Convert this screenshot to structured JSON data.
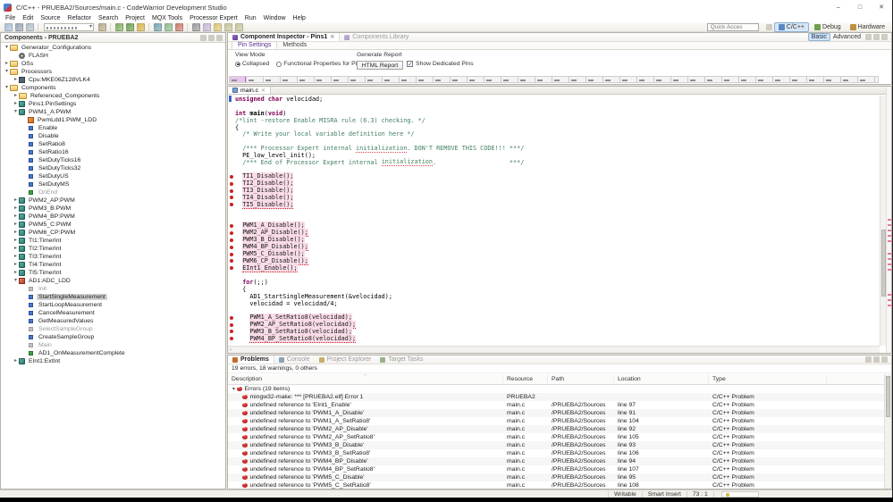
{
  "window": {
    "title": "C/C++ - PRUEBA2/Sources/main.c - CodeWarrior Development Studio",
    "controls": {
      "minimize": "–",
      "restore": "□",
      "close": "✕"
    }
  },
  "menu": {
    "items": [
      "File",
      "Edit",
      "Source",
      "Refactor",
      "Search",
      "Project",
      "MQX Tools",
      "Processor Expert",
      "Run",
      "Window",
      "Help"
    ]
  },
  "toolbar": {
    "quick_access": "Quick Acces",
    "icons": [
      {
        "name": "new-wizard-icon",
        "color": "#a8bed8"
      },
      {
        "name": "save-icon",
        "color": "#9aa7b5"
      },
      {
        "name": "save-all-icon",
        "color": "#b4bec8"
      },
      {
        "name": "build-icon",
        "color": "#b9a98a"
      },
      {
        "name": "debug-icon",
        "color": "#7fae5f"
      },
      {
        "name": "run-icon",
        "color": "#6f9e4f"
      },
      {
        "name": "flash-programmer-icon",
        "color": "#d8b44a"
      },
      {
        "name": "step-icon",
        "color": "#76a5af"
      },
      {
        "name": "resume-icon",
        "color": "#8fbc8f"
      },
      {
        "name": "terminate-icon",
        "color": "#c97a6a"
      },
      {
        "name": "search-icon",
        "color": "#9a9a9a"
      },
      {
        "name": "annotation-icon",
        "color": "#c8b8d8"
      },
      {
        "name": "mark-icon",
        "color": "#d8c878"
      },
      {
        "name": "nav-back-icon",
        "color": "#c8c49a"
      },
      {
        "name": "nav-forward-icon",
        "color": "#c8c49a"
      }
    ],
    "perspectives": [
      {
        "label": "C/C++",
        "active": true,
        "color": "#5a87c6"
      },
      {
        "label": "Debug",
        "active": false,
        "color": "#6fa050"
      },
      {
        "label": "Hardware",
        "active": false,
        "color": "#c09040"
      }
    ]
  },
  "components_view": {
    "title": "Components - PRUEBA2",
    "tree": [
      {
        "label": "Generator_Configurations",
        "lvl": 0,
        "arrow": "exp",
        "icon": "folder"
      },
      {
        "label": "FLASH",
        "lvl": 1,
        "arrow": null,
        "icon": "gear"
      },
      {
        "label": "OSs",
        "lvl": 0,
        "arrow": "col",
        "icon": "folder"
      },
      {
        "label": "Processors",
        "lvl": 0,
        "arrow": "exp",
        "icon": "folder"
      },
      {
        "label": "Cpu:MKE06Z128VLK4",
        "lvl": 1,
        "arrow": "col",
        "icon": "cpu"
      },
      {
        "label": "Components",
        "lvl": 0,
        "arrow": "exp",
        "icon": "folder"
      },
      {
        "label": "Referenced_Components",
        "lvl": 1,
        "arrow": "col",
        "icon": "folder"
      },
      {
        "label": "Pins1:PinSettings",
        "lvl": 1,
        "arrow": "col",
        "icon": "comp"
      },
      {
        "label": "PWM1_A:PWM",
        "lvl": 1,
        "arrow": "exp",
        "icon": "comp"
      },
      {
        "label": "PwmLdd1:PWM_LDD",
        "lvl": 2,
        "arrow": null,
        "icon": "ldd"
      },
      {
        "label": "Enable",
        "lvl": 2,
        "arrow": null,
        "icon": "method"
      },
      {
        "label": "Disable",
        "lvl": 2,
        "arrow": null,
        "icon": "method"
      },
      {
        "label": "SetRatio8",
        "lvl": 2,
        "arrow": null,
        "icon": "method"
      },
      {
        "label": "SetRatio16",
        "lvl": 2,
        "arrow": null,
        "icon": "method"
      },
      {
        "label": "SetDutyTicks16",
        "lvl": 2,
        "arrow": null,
        "icon": "method"
      },
      {
        "label": "SetDutyTicks32",
        "lvl": 2,
        "arrow": null,
        "icon": "method"
      },
      {
        "label": "SetDutyUS",
        "lvl": 2,
        "arrow": null,
        "icon": "method"
      },
      {
        "label": "SetDutyMS",
        "lvl": 2,
        "arrow": null,
        "icon": "method"
      },
      {
        "label": "OnEnd",
        "lvl": 2,
        "arrow": null,
        "icon": "event",
        "gray": true
      },
      {
        "label": "PWM2_AP:PWM",
        "lvl": 1,
        "arrow": "col",
        "icon": "comp"
      },
      {
        "label": "PWM3_B:PWM",
        "lvl": 1,
        "arrow": "col",
        "icon": "comp"
      },
      {
        "label": "PWM4_BP:PWM",
        "lvl": 1,
        "arrow": "col",
        "icon": "comp"
      },
      {
        "label": "PWM5_C:PWM",
        "lvl": 1,
        "arrow": "col",
        "icon": "comp"
      },
      {
        "label": "PWM6_CP:PWM",
        "lvl": 1,
        "arrow": "col",
        "icon": "comp"
      },
      {
        "label": "TI1:TimerInt",
        "lvl": 1,
        "arrow": "col",
        "icon": "comp"
      },
      {
        "label": "TI2:TimerInt",
        "lvl": 1,
        "arrow": "col",
        "icon": "comp"
      },
      {
        "label": "TI3:TimerInt",
        "lvl": 1,
        "arrow": "col",
        "icon": "comp"
      },
      {
        "label": "TI4:TimerInt",
        "lvl": 1,
        "arrow": "col",
        "icon": "comp"
      },
      {
        "label": "TI5:TimerInt",
        "lvl": 1,
        "arrow": "col",
        "icon": "comp"
      },
      {
        "label": "AD1:ADC_LDD",
        "lvl": 1,
        "arrow": "exp",
        "icon": "adc"
      },
      {
        "label": "Init",
        "lvl": 2,
        "arrow": null,
        "icon": "method_gray",
        "gray": true
      },
      {
        "label": "StartSingleMeasurement",
        "lvl": 2,
        "arrow": null,
        "icon": "method",
        "sel": true
      },
      {
        "label": "StartLoopMeasurement",
        "lvl": 2,
        "arrow": null,
        "icon": "method"
      },
      {
        "label": "CancelMeasurement",
        "lvl": 2,
        "arrow": null,
        "icon": "method"
      },
      {
        "label": "GetMeasuredValues",
        "lvl": 2,
        "arrow": null,
        "icon": "method"
      },
      {
        "label": "SelectSampleGroup",
        "lvl": 2,
        "arrow": null,
        "icon": "method_gray",
        "gray": true
      },
      {
        "label": "CreateSampleGroup",
        "lvl": 2,
        "arrow": null,
        "icon": "method"
      },
      {
        "label": "Main",
        "lvl": 2,
        "arrow": null,
        "icon": "method_gray",
        "gray": true
      },
      {
        "label": "AD1_OnMeasurementComplete",
        "lvl": 2,
        "arrow": null,
        "icon": "event"
      },
      {
        "label": "EInt1:ExtInt",
        "lvl": 1,
        "arrow": "col",
        "icon": "comp"
      }
    ]
  },
  "inspector": {
    "tab_active": "Component Inspector - Pins1",
    "tab_inactive": "Components Library",
    "subtab_pin": "Pin Settings",
    "subtab_methods": "Methods",
    "view_mode_label": "View Mode",
    "radio_collapsed": "Collapsed",
    "radio_functional": "Functional Properties for Pins",
    "generate_report_label": "Generate Report",
    "report_button": "HTML Report",
    "dedicated_pins_label": "Show Dedicated Pins",
    "dedicated_pins_checked": "✓",
    "basic_tab": "Basic",
    "advanced_tab": "Advanced"
  },
  "editor": {
    "tab": "main.c",
    "close_glyph": "✕",
    "hscroll_arrow": "‹",
    "error_color": "#cc2222",
    "keyword_color": "#7f0055",
    "comment_color": "#3f7f5f",
    "lines": [
      {
        "m": "cur",
        "s": [
          [
            "k",
            "unsigned"
          ],
          [
            "p",
            " "
          ],
          [
            "k",
            "char"
          ],
          [
            "p",
            " velocidad;"
          ]
        ]
      },
      {
        "m": null,
        "s": []
      },
      {
        "m": null,
        "s": [
          [
            "k",
            "int"
          ],
          [
            "p",
            " "
          ],
          [
            "b",
            "main"
          ],
          [
            "p",
            "("
          ],
          [
            "k",
            "void"
          ],
          [
            "p",
            ")"
          ]
        ]
      },
      {
        "m": null,
        "s": [
          [
            "c",
            "/*lint -restore Enable MISRA rule (6.3) checking. */"
          ]
        ]
      },
      {
        "m": null,
        "s": [
          [
            "p",
            "{"
          ]
        ]
      },
      {
        "m": null,
        "s": [
          [
            "p",
            "  "
          ],
          [
            "c",
            "/* Write your local variable definition here */"
          ]
        ]
      },
      {
        "m": null,
        "s": []
      },
      {
        "m": null,
        "s": [
          [
            "p",
            "  "
          ],
          [
            "c",
            "/*** Processor Expert internal "
          ],
          [
            "cu",
            "initialization"
          ],
          [
            "c",
            ". DON'T REMOVE THIS CODE!!! ***/"
          ]
        ]
      },
      {
        "m": null,
        "s": [
          [
            "p",
            "  PE_low_level_init();"
          ]
        ]
      },
      {
        "m": null,
        "s": [
          [
            "p",
            "  "
          ],
          [
            "c",
            "/*** End of Processor Expert internal "
          ],
          [
            "cu",
            "initialization"
          ],
          [
            "c",
            ".                    ***/"
          ]
        ]
      },
      {
        "m": null,
        "s": []
      },
      {
        "m": "err",
        "s": [
          [
            "p",
            "  "
          ],
          [
            "e",
            "TI1_Disable();"
          ]
        ]
      },
      {
        "m": "err",
        "s": [
          [
            "p",
            "  "
          ],
          [
            "e",
            "TI2_Disable();"
          ]
        ]
      },
      {
        "m": "err",
        "s": [
          [
            "p",
            "  "
          ],
          [
            "e",
            "TI3_Disable();"
          ]
        ]
      },
      {
        "m": "err",
        "s": [
          [
            "p",
            "  "
          ],
          [
            "e",
            "TI4_Disable();"
          ]
        ]
      },
      {
        "m": "err",
        "s": [
          [
            "p",
            "  "
          ],
          [
            "e",
            "TI5_Disable();"
          ]
        ]
      },
      {
        "m": null,
        "s": []
      },
      {
        "m": null,
        "s": []
      },
      {
        "m": "err",
        "s": [
          [
            "p",
            "  "
          ],
          [
            "e",
            "PWM1_A_Disable();"
          ]
        ]
      },
      {
        "m": "err",
        "s": [
          [
            "p",
            "  "
          ],
          [
            "e",
            "PWM2_AP_Disable();"
          ]
        ]
      },
      {
        "m": "err",
        "s": [
          [
            "p",
            "  "
          ],
          [
            "e",
            "PWM3_B_Disable();"
          ]
        ]
      },
      {
        "m": "err",
        "s": [
          [
            "p",
            "  "
          ],
          [
            "e",
            "PWM4_BP_Disable();"
          ]
        ]
      },
      {
        "m": "err",
        "s": [
          [
            "p",
            "  "
          ],
          [
            "e",
            "PWM5_C_Disable();"
          ]
        ]
      },
      {
        "m": "err",
        "s": [
          [
            "p",
            "  "
          ],
          [
            "e",
            "PWM6_CP_Disable();"
          ]
        ]
      },
      {
        "m": "err",
        "s": [
          [
            "p",
            "  "
          ],
          [
            "e",
            "EInt1_Enable();"
          ]
        ]
      },
      {
        "m": null,
        "s": []
      },
      {
        "m": null,
        "s": [
          [
            "p",
            "  "
          ],
          [
            "k",
            "for"
          ],
          [
            "p",
            "(;;)"
          ]
        ]
      },
      {
        "m": null,
        "s": [
          [
            "p",
            "  {"
          ]
        ]
      },
      {
        "m": null,
        "s": [
          [
            "p",
            "    AD1_StartSingleMeasurement(&velocidad);"
          ]
        ]
      },
      {
        "m": null,
        "s": [
          [
            "p",
            "    velocidad = velocidad/4;"
          ]
        ]
      },
      {
        "m": null,
        "s": []
      },
      {
        "m": "err",
        "s": [
          [
            "p",
            "    "
          ],
          [
            "e",
            "PWM1_A_SetRatio8(velocidad);"
          ]
        ]
      },
      {
        "m": "err",
        "s": [
          [
            "p",
            "    "
          ],
          [
            "e",
            "PWM2_AP_SetRatio8(velocidad);"
          ]
        ]
      },
      {
        "m": "err",
        "s": [
          [
            "p",
            "    "
          ],
          [
            "e",
            "PWM3_B_SetRatio8(velocidad);"
          ]
        ]
      },
      {
        "m": "err",
        "s": [
          [
            "p",
            "    "
          ],
          [
            "e",
            "PWM4_BP_SetRatio8(velocidad);"
          ]
        ]
      }
    ]
  },
  "problems": {
    "tabs": [
      {
        "label": "Problems",
        "active": true,
        "icon": "problems-icon",
        "icon_color": "#c86a2a"
      },
      {
        "label": "Console",
        "active": false,
        "icon": "console-icon",
        "icon_color": "#8aa0b8"
      },
      {
        "label": "Project Explorer",
        "active": false,
        "icon": "project-explorer-icon",
        "icon_color": "#c8b06a"
      },
      {
        "label": "Target Tasks",
        "active": false,
        "icon": "target-tasks-icon",
        "icon_color": "#9ab08a"
      }
    ],
    "summary": "19 errors, 18 warnings, 0 others",
    "columns": [
      "Description",
      "Resource",
      "Path",
      "Location",
      "Type"
    ],
    "group_label": "Errors (19 items)",
    "rows": [
      {
        "desc": "mingw32-make: *** [PRUEBA2.elf] Error 1",
        "res": "PRUEBA2",
        "path": "",
        "loc": "",
        "type": "C/C++ Problem"
      },
      {
        "desc": "undefined reference to 'EInt1_Enable'",
        "res": "main.c",
        "path": "/PRUEBA2/Sources",
        "loc": "line 97",
        "type": "C/C++ Problem"
      },
      {
        "desc": "undefined reference to 'PWM1_A_Disable'",
        "res": "main.c",
        "path": "/PRUEBA2/Sources",
        "loc": "line 91",
        "type": "C/C++ Problem"
      },
      {
        "desc": "undefined reference to 'PWM1_A_SetRatio8'",
        "res": "main.c",
        "path": "/PRUEBA2/Sources",
        "loc": "line 104",
        "type": "C/C++ Problem"
      },
      {
        "desc": "undefined reference to 'PWM2_AP_Disable'",
        "res": "main.c",
        "path": "/PRUEBA2/Sources",
        "loc": "line 92",
        "type": "C/C++ Problem"
      },
      {
        "desc": "undefined reference to 'PWM2_AP_SetRatio8'",
        "res": "main.c",
        "path": "/PRUEBA2/Sources",
        "loc": "line 105",
        "type": "C/C++ Problem"
      },
      {
        "desc": "undefined reference to 'PWM3_B_Disable'",
        "res": "main.c",
        "path": "/PRUEBA2/Sources",
        "loc": "line 93",
        "type": "C/C++ Problem"
      },
      {
        "desc": "undefined reference to 'PWM3_B_SetRatio8'",
        "res": "main.c",
        "path": "/PRUEBA2/Sources",
        "loc": "line 106",
        "type": "C/C++ Problem"
      },
      {
        "desc": "undefined reference to 'PWM4_BP_Disable'",
        "res": "main.c",
        "path": "/PRUEBA2/Sources",
        "loc": "line 94",
        "type": "C/C++ Problem"
      },
      {
        "desc": "undefined reference to 'PWM4_BP_SetRatio8'",
        "res": "main.c",
        "path": "/PRUEBA2/Sources",
        "loc": "line 107",
        "type": "C/C++ Problem"
      },
      {
        "desc": "undefined reference to 'PWM5_C_Disable'",
        "res": "main.c",
        "path": "/PRUEBA2/Sources",
        "loc": "line 95",
        "type": "C/C++ Problem"
      },
      {
        "desc": "undefined reference to 'PWM5_C_SetRatio8'",
        "res": "main.c",
        "path": "/PRUEBA2/Sources",
        "loc": "line 108",
        "type": "C/C++ Problem"
      }
    ]
  },
  "status": {
    "writable": "Writable",
    "insert_mode": "Smart Insert",
    "position": "73 : 1"
  }
}
